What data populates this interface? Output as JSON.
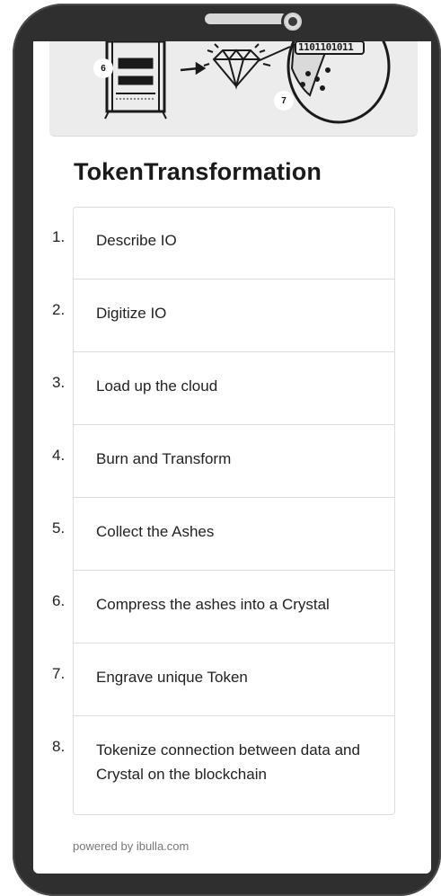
{
  "banner": {
    "badges": [
      "6",
      "7"
    ],
    "binary_text": "1101101011",
    "illustration_icons": [
      "server-rack-icon",
      "arrow-right-icon",
      "diamond-crystal-icon",
      "blockchain-disc-icon"
    ]
  },
  "page": {
    "title": "TokenTransformation"
  },
  "steps": [
    {
      "number": "1.",
      "label": "Describe IO"
    },
    {
      "number": "2.",
      "label": "Digitize IO"
    },
    {
      "number": "3.",
      "label": "Load up the cloud"
    },
    {
      "number": "4.",
      "label": "Burn and Transform"
    },
    {
      "number": "5.",
      "label": "Collect the Ashes"
    },
    {
      "number": "6.",
      "label": "Compress the ashes into a Crystal"
    },
    {
      "number": "7.",
      "label": "Engrave unique Token"
    },
    {
      "number": "8.",
      "label": "Tokenize connection between data and Crystal on the blockchain"
    }
  ],
  "footer": {
    "text": "powered by ibulla.com"
  },
  "colors": {
    "device_frame": "#2f2f2f",
    "banner_bg": "#ececec",
    "border": "#dedede",
    "text": "#222222",
    "footer_text": "#777777"
  }
}
